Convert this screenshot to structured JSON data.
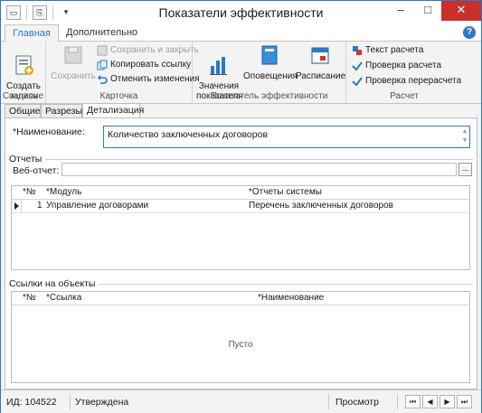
{
  "window": {
    "title": "Показатели эффективности",
    "controls": {
      "minimize": "–",
      "maximize": "□",
      "close": "✕"
    }
  },
  "ribbon_tabs": [
    {
      "label": "Главная",
      "active": true
    },
    {
      "label": "Дополнительно",
      "active": false
    }
  ],
  "help_label": "?",
  "ribbon": {
    "create_group": {
      "label": "Создание",
      "create_button": "Создать\nзапись"
    },
    "card_group": {
      "label": "Карточка",
      "save_button": "Сохранить",
      "save_close": "Сохранить и закрыть",
      "copy_link": "Копировать ссылку",
      "undo_changes": "Отменить изменения"
    },
    "indicator_group": {
      "label": "Показатель эффективности",
      "values_button": "Значения\nпоказателя",
      "alerts_button": "Оповещения",
      "schedule_button": "Расписание"
    },
    "calc_group": {
      "label": "Расчет",
      "calc_text": "Текст расчета",
      "check_calc": "Проверка расчета",
      "check_recalc": "Проверка перерасчета"
    }
  },
  "form_tabs": [
    {
      "label": "Общие",
      "active": false
    },
    {
      "label": "Разрезы",
      "active": false
    },
    {
      "label": "Детализация",
      "active": true
    }
  ],
  "detail": {
    "name_label": "*Наименование:",
    "name_value": "Количество заключенных договоров",
    "reports_section": "Отчеты",
    "web_report_label": "Веб-отчет:",
    "web_report_value": "",
    "browse_label": "...",
    "reports_grid": {
      "columns": [
        "*№",
        "*Модуль",
        "*Отчеты системы"
      ],
      "rows": [
        {
          "num": "1",
          "module": "Управление договорами",
          "report": "Перечень заключенных договоров"
        }
      ]
    },
    "links_section": "Ссылки на объекты",
    "links_grid": {
      "columns": [
        "*№",
        "*Ссылка",
        "*Наименование"
      ],
      "empty_text": "Пусто"
    }
  },
  "status": {
    "id": "ИД: 104522",
    "state": "Утверждена",
    "mode": "Просмотр",
    "nav": [
      "⏮",
      "◀",
      "▶",
      "⏭"
    ]
  },
  "colors": {
    "accent": "#2b78c5",
    "close": "#c7302b"
  }
}
